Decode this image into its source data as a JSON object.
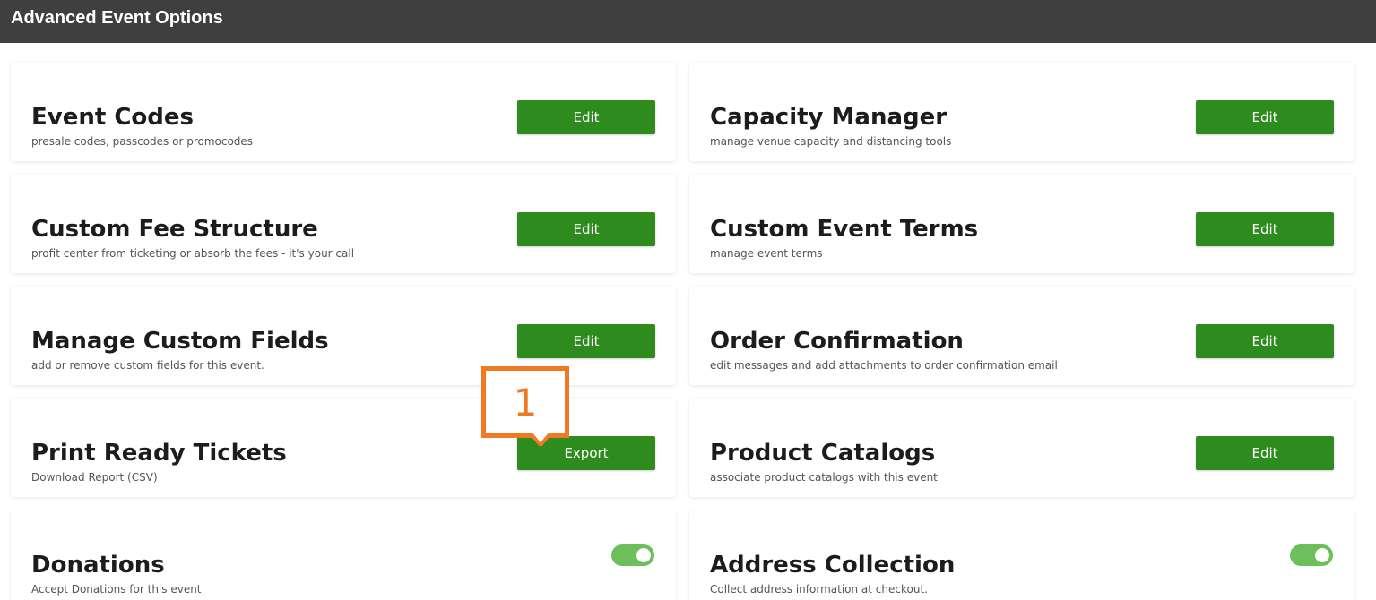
{
  "header": {
    "title": "Advanced Event Options"
  },
  "cards": [
    {
      "title": "Event Codes",
      "subtitle": "presale codes, passcodes or promocodes",
      "button": "Edit"
    },
    {
      "title": "Capacity Manager",
      "subtitle": "manage venue capacity and distancing tools",
      "button": "Edit"
    },
    {
      "title": "Custom Fee Structure",
      "subtitle": "profit center from ticketing or absorb the fees - it's your call",
      "button": "Edit"
    },
    {
      "title": "Custom Event Terms",
      "subtitle": "manage event terms",
      "button": "Edit"
    },
    {
      "title": "Manage Custom Fields",
      "subtitle": "add or remove custom fields for this event.",
      "button": "Edit"
    },
    {
      "title": "Order Confirmation",
      "subtitle": "edit messages and add attachments to order confirmation email",
      "button": "Edit"
    },
    {
      "title": "Print Ready Tickets",
      "subtitle": "Download Report (CSV)",
      "button": "Export"
    },
    {
      "title": "Product Catalogs",
      "subtitle": "associate product catalogs with this event",
      "button": "Edit"
    },
    {
      "title": "Donations",
      "subtitle": "Accept Donations for this event",
      "toggle": "on"
    },
    {
      "title": "Address Collection",
      "subtitle": "Collect address information at checkout.",
      "toggle": "on"
    }
  ],
  "callout": {
    "label": "1"
  },
  "colors": {
    "header": "#3f3f3f",
    "button": "#2e8b1e",
    "toggle": "#6cbf5a",
    "callout": "#f07a24"
  }
}
